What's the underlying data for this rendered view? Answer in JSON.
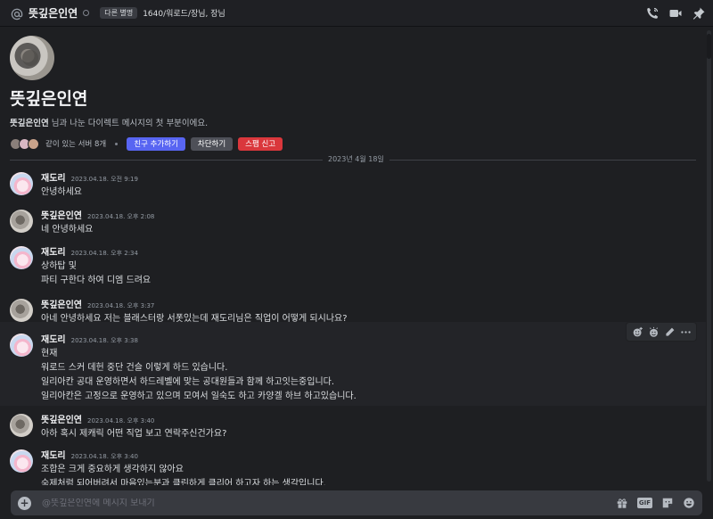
{
  "header": {
    "name": "뜻깊은인연",
    "tag": "다른 별명",
    "subtitle": "1640/워로드/장님, 장님"
  },
  "intro": {
    "title": "뜻깊은인연",
    "text_name": "뜻깊은인연",
    "text_rest": " 님과 나눈 다이렉트 메시지의 첫 부분이에요.",
    "mutual_servers": "같이 있는 서버 8개",
    "buttons": {
      "add_friend": "친구 추가하기",
      "block": "차단하기",
      "report_spam": "스팸 신고"
    }
  },
  "date_divider": "2023년 4월 18일",
  "messages": [
    {
      "author": "재도리",
      "time": "2023.04.18. 오전 9:19",
      "lines": [
        "안녕하세요"
      ]
    },
    {
      "author": "뜻깊은인연",
      "time": "2023.04.18. 오후 2:08",
      "lines": [
        "네 안녕하세요"
      ]
    },
    {
      "author": "재도리",
      "time": "2023.04.18. 오후 2:34",
      "lines": [
        "상하탑 및",
        "파티 구한다 하여 디엠 드려요"
      ]
    },
    {
      "author": "뜻깊은인연",
      "time": "2023.04.18. 오후 3:37",
      "lines": [
        "아네 안녕하세요 저는 블래스터랑 서폿있는데 재도리님은 직업이 어떻게 되시나요?"
      ]
    },
    {
      "author": "재도리",
      "time": "2023.04.18. 오후 3:38",
      "lines": [
        "현재",
        "워로드 스커 데헌 중단 건슬 이렇게 하드 있습니다.",
        "일리아칸 공대 운영하면서 하드레벨에 맞는 공대원들과 함께 하고잇는중입니다.",
        "일리아칸은 고정으로 운영하고 있으며 모여서 일숙도 하고 카양겔 하브 하고있습니다."
      ]
    },
    {
      "author": "뜻깊은인연",
      "time": "2023.04.18. 오후 3:40",
      "lines": [
        "아하 혹시 제캐릭 어떤 직업 보고 연락주신건가요?"
      ]
    },
    {
      "author": "재도리",
      "time": "2023.04.18. 오후 3:40",
      "lines": [
        "조합은 크게 중요하게 생각하지 않아요",
        "숙제처럼 되어버려서 마음있는분과 클린하게 클리어 하고자 하는 생각입니다."
      ]
    }
  ],
  "composer": {
    "placeholder": "@뜻깊은인연에 메시지 보내기",
    "gif_label": "GIF"
  },
  "icons": {
    "header": [
      "at-icon",
      "phone-icon",
      "video-icon",
      "pin-icon"
    ],
    "toolbar": [
      "add-reaction-icon",
      "super-reaction-icon",
      "edit-icon",
      "more-icon"
    ],
    "composer": [
      "plus-icon",
      "gift-icon",
      "gif-icon",
      "sticker-icon",
      "emoji-icon"
    ]
  },
  "colors": {
    "accent_blue": "#5865f2",
    "danger_red": "#da373c",
    "secondary_gray": "#4e5058",
    "background": "#1e1f22"
  }
}
